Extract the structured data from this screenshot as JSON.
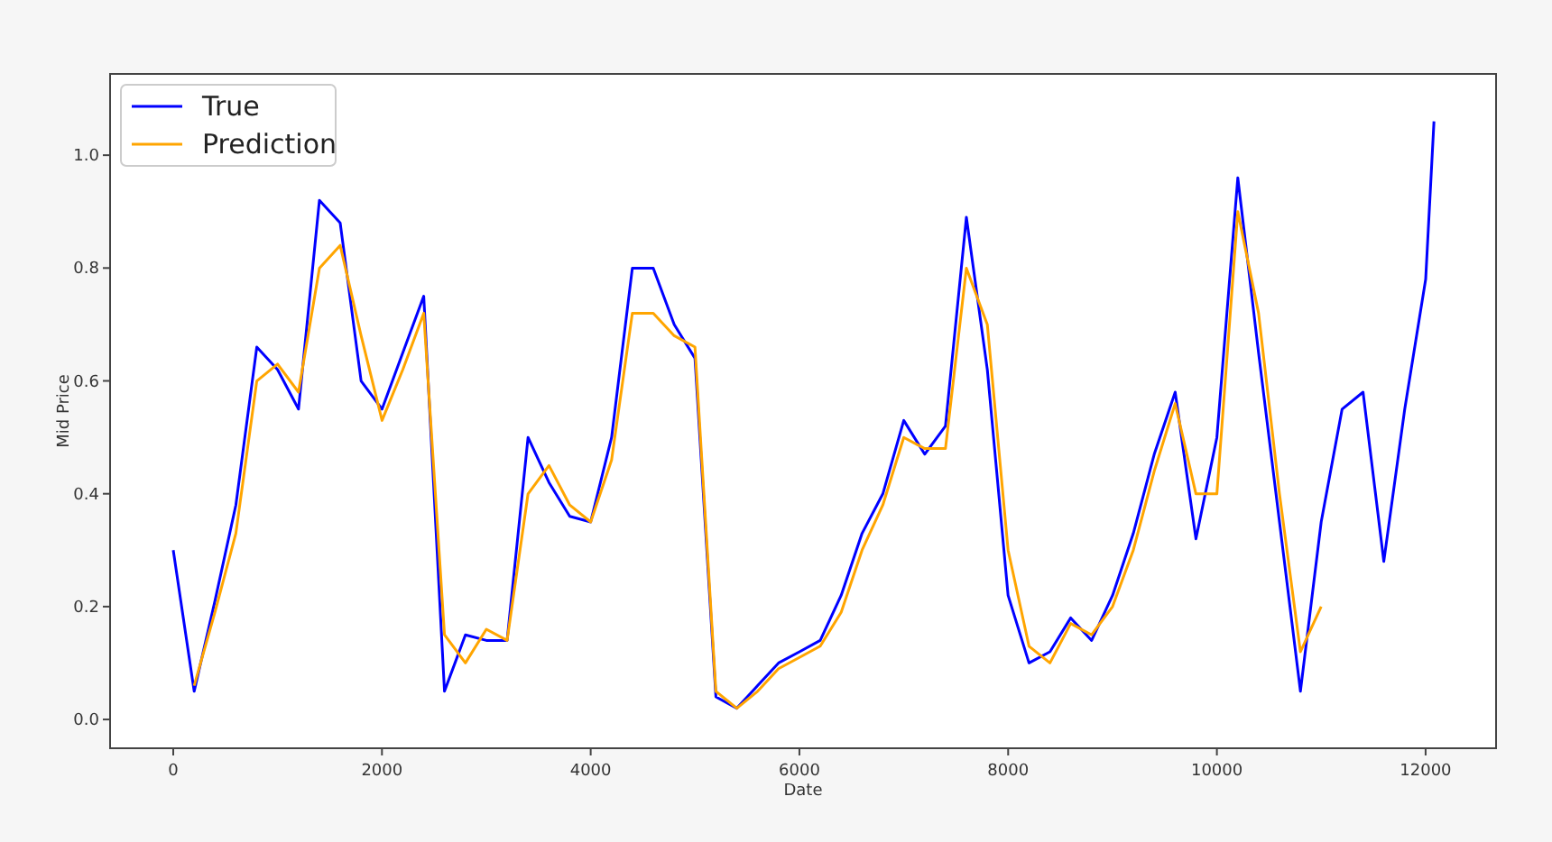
{
  "chart_data": {
    "type": "line",
    "xlabel": "Date",
    "ylabel": "Mid Price",
    "x": [
      0,
      200,
      400,
      600,
      800,
      1000,
      1200,
      1400,
      1600,
      1800,
      2000,
      2200,
      2400,
      2600,
      2800,
      3000,
      3200,
      3400,
      3600,
      3800,
      4000,
      4200,
      4400,
      4600,
      4800,
      5000,
      5200,
      5400,
      5600,
      5800,
      6000,
      6200,
      6400,
      6600,
      6800,
      7000,
      7200,
      7400,
      7600,
      7800,
      8000,
      8200,
      8400,
      8600,
      8800,
      9000,
      9200,
      9400,
      9600,
      9800,
      10000,
      10200,
      10400,
      10600,
      10800,
      11000,
      11200,
      11400,
      11600,
      11800,
      12000,
      12080
    ],
    "series": [
      {
        "name": "True",
        "color": "#0000ff",
        "values": [
          0.3,
          0.05,
          0.21,
          0.38,
          0.66,
          0.62,
          0.55,
          0.92,
          0.88,
          0.6,
          0.55,
          0.65,
          0.75,
          0.05,
          0.15,
          0.14,
          0.14,
          0.5,
          0.42,
          0.36,
          0.35,
          0.5,
          0.8,
          0.8,
          0.7,
          0.64,
          0.04,
          0.02,
          0.06,
          0.1,
          0.12,
          0.14,
          0.22,
          0.33,
          0.4,
          0.53,
          0.47,
          0.52,
          0.89,
          0.62,
          0.22,
          0.1,
          0.12,
          0.18,
          0.14,
          0.22,
          0.33,
          0.47,
          0.58,
          0.32,
          0.5,
          0.96,
          0.65,
          0.35,
          0.05,
          0.35,
          0.55,
          0.58,
          0.28,
          0.55,
          0.78,
          1.06
        ]
      },
      {
        "name": "Prediction",
        "color": "#ffa500",
        "values": [
          null,
          0.06,
          0.19,
          0.33,
          0.6,
          0.63,
          0.58,
          0.8,
          0.84,
          0.68,
          0.53,
          0.62,
          0.72,
          0.15,
          0.1,
          0.16,
          0.14,
          0.4,
          0.45,
          0.38,
          0.35,
          0.46,
          0.72,
          0.72,
          0.68,
          0.66,
          0.05,
          0.02,
          0.05,
          0.09,
          0.11,
          0.13,
          0.19,
          0.3,
          0.38,
          0.5,
          0.48,
          0.48,
          0.8,
          0.7,
          0.3,
          0.13,
          0.1,
          0.17,
          0.15,
          0.2,
          0.3,
          0.44,
          0.56,
          0.4,
          0.4,
          0.9,
          0.72,
          0.4,
          0.12,
          0.2,
          null,
          null,
          null,
          null,
          null,
          null
        ]
      }
    ],
    "legend": true,
    "xlim": [
      -605,
      12675
    ],
    "ylim": [
      -0.051,
      1.144
    ],
    "xticks": [
      0,
      2000,
      4000,
      6000,
      8000,
      10000,
      12000
    ],
    "yticks": [
      {
        "value": 0,
        "label": "0.0"
      },
      {
        "value": 0.2,
        "label": "0.2"
      },
      {
        "value": 0.4,
        "label": "0.4"
      },
      {
        "value": 0.6,
        "label": "0.6"
      },
      {
        "value": 0.8,
        "label": "0.8"
      },
      {
        "value": 1,
        "label": "1.0"
      }
    ]
  }
}
